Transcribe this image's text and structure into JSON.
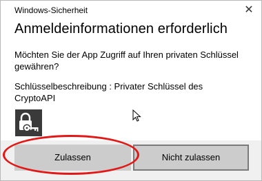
{
  "window": {
    "title": "Windows-Sicherheit",
    "close_glyph": "✕"
  },
  "dialog": {
    "heading": "Anmeldeinformationen erforderlich",
    "question": "Möchten Sie der App Zugriff auf Ihren privaten Schlüssel gewähren?",
    "description_label": "Schlüsselbeschreibung",
    "description_sep": " : ",
    "description_value": "Privater Schlüssel des CryptoAPI",
    "key_icon": "lock-key-icon"
  },
  "buttons": {
    "allow_label": "Zulassen",
    "deny_label": "Nicht zulassen"
  },
  "colors": {
    "highlight": "#e11818",
    "button": "#cccccc",
    "icon_bg": "#3a3a3a"
  }
}
